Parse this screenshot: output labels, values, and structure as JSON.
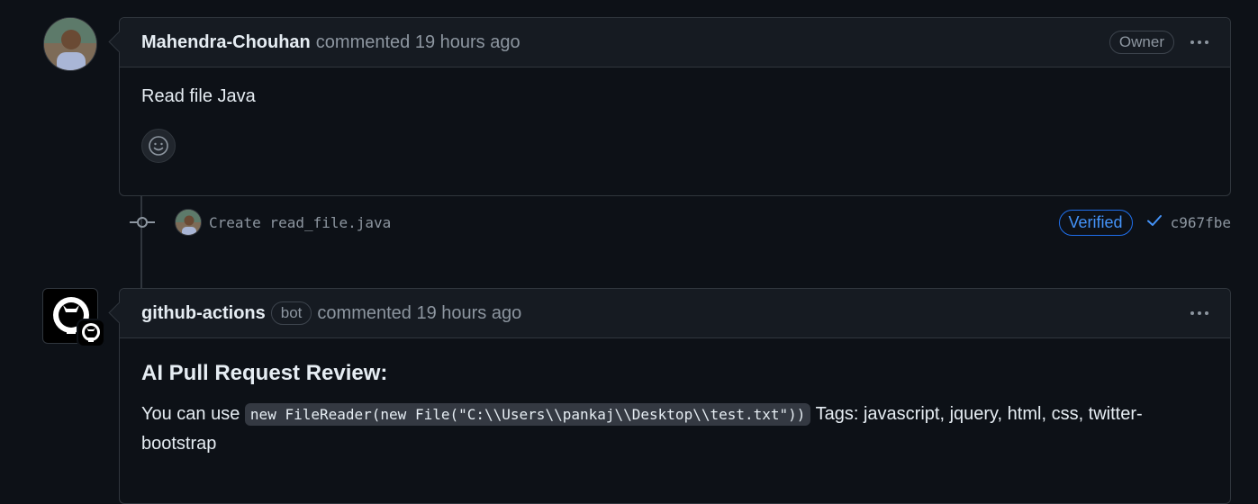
{
  "comment1": {
    "author": "Mahendra-Chouhan",
    "action": "commented 19 hours ago",
    "role": "Owner",
    "body": "Read file Java"
  },
  "commit": {
    "message": "Create read_file.java",
    "verified": "Verified",
    "sha": "c967fbe"
  },
  "comment2": {
    "author": "github-actions",
    "badge": "bot",
    "action": "commented 19 hours ago",
    "heading": "AI Pull Request Review:",
    "text_before": "You can use",
    "code": "new FileReader(new File(\"C:\\\\Users\\\\pankaj\\\\Desktop\\\\test.txt\"))",
    "text_after": "Tags: javascript, jquery, html, css, twitter-bootstrap"
  },
  "colors": {
    "background": "#0d1117",
    "header_bg": "#161b22",
    "border": "#30363d",
    "muted": "#8d96a0",
    "accent": "#4493f8"
  },
  "icons": [
    "smiley-icon",
    "kebab-icon",
    "commit-icon",
    "check-icon",
    "github-mark-icon"
  ]
}
